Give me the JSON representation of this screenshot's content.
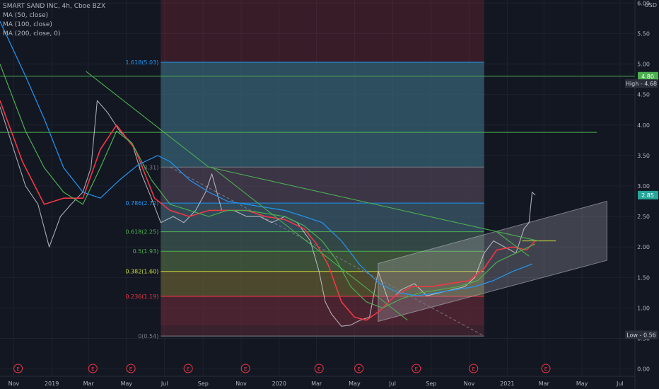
{
  "chart_data": {
    "type": "line",
    "title": "SMART SAND INC, 4h, Cboe BZX",
    "currency": "USD",
    "indicators": [
      "MA (50, close)",
      "MA (100, close)",
      "MA (200, close, 0)"
    ],
    "x_tick_labels": [
      "Nov",
      "2019",
      "Mar",
      "May",
      "Jul",
      "Sep",
      "Nov",
      "2020",
      "Mar",
      "May",
      "Jul",
      "Sep",
      "Nov",
      "2021",
      "Mar",
      "May",
      "Jul"
    ],
    "x_tick_dates": [
      "2018-11-01",
      "2019-01-01",
      "2019-03-01",
      "2019-05-01",
      "2019-07-01",
      "2019-09-01",
      "2019-11-01",
      "2020-01-01",
      "2020-03-01",
      "2020-05-01",
      "2020-07-01",
      "2020-09-01",
      "2020-11-01",
      "2021-01-01",
      "2021-03-01",
      "2021-05-01",
      "2021-07-01"
    ],
    "y_ticks": [
      "6.00",
      "5.50",
      "5.00",
      "4.50",
      "4.00",
      "3.50",
      "3.00",
      "2.50",
      "2.00",
      "1.50",
      "1.00",
      "0.50",
      "0.00"
    ],
    "ylim": [
      -0.12,
      6.05
    ],
    "xlim": [
      "2018-10-10",
      "2021-07-25"
    ],
    "price": {
      "x": [
        "2018-10-10",
        "2018-11-01",
        "2018-11-20",
        "2018-12-10",
        "2018-12-28",
        "2019-01-15",
        "2019-02-01",
        "2019-02-20",
        "2019-03-05",
        "2019-03-15",
        "2019-04-01",
        "2019-04-20",
        "2019-05-10",
        "2019-05-25",
        "2019-06-10",
        "2019-06-25",
        "2019-07-15",
        "2019-08-01",
        "2019-08-20",
        "2019-09-05",
        "2019-09-15",
        "2019-10-01",
        "2019-10-20",
        "2019-11-10",
        "2019-12-01",
        "2019-12-20",
        "2020-01-10",
        "2020-01-30",
        "2020-02-20",
        "2020-03-05",
        "2020-03-15",
        "2020-03-25",
        "2020-04-10",
        "2020-04-25",
        "2020-05-10",
        "2020-05-25",
        "2020-06-08",
        "2020-06-25",
        "2020-07-15",
        "2020-08-05",
        "2020-08-25",
        "2020-09-15",
        "2020-10-05",
        "2020-10-25",
        "2020-11-10",
        "2020-11-25",
        "2020-12-10",
        "2020-12-28",
        "2021-01-15",
        "2021-01-28",
        "2021-02-05",
        "2021-02-10",
        "2021-02-15"
      ],
      "y": [
        4.3,
        3.6,
        3.0,
        2.7,
        2.0,
        2.5,
        2.7,
        2.9,
        3.3,
        4.4,
        4.2,
        3.9,
        3.7,
        3.2,
        2.8,
        2.4,
        2.5,
        2.4,
        2.6,
        2.9,
        3.2,
        2.6,
        2.6,
        2.5,
        2.5,
        2.4,
        2.5,
        2.4,
        2.1,
        1.6,
        1.1,
        0.9,
        0.7,
        0.72,
        0.8,
        0.85,
        1.6,
        1.1,
        1.3,
        1.4,
        1.2,
        1.25,
        1.3,
        1.35,
        1.5,
        1.9,
        2.1,
        2.0,
        1.9,
        2.3,
        2.4,
        2.9,
        2.85
      ]
    },
    "series": [
      {
        "name": "MA (50, close)",
        "color": "#f23645",
        "x": [
          "2018-10-10",
          "2018-11-15",
          "2018-12-20",
          "2019-01-20",
          "2019-02-20",
          "2019-03-20",
          "2019-04-15",
          "2019-05-15",
          "2019-06-15",
          "2019-07-10",
          "2019-08-10",
          "2019-09-10",
          "2019-10-10",
          "2019-11-10",
          "2019-12-10",
          "2020-01-10",
          "2020-02-10",
          "2020-03-01",
          "2020-03-20",
          "2020-04-10",
          "2020-05-01",
          "2020-05-20",
          "2020-06-10",
          "2020-07-05",
          "2020-08-01",
          "2020-09-01",
          "2020-10-01",
          "2020-11-01",
          "2020-11-25",
          "2020-12-15",
          "2021-01-10",
          "2021-02-01",
          "2021-02-15"
        ],
        "y": [
          4.4,
          3.4,
          2.7,
          2.8,
          2.8,
          3.6,
          4.0,
          3.6,
          2.8,
          2.6,
          2.5,
          2.6,
          2.6,
          2.6,
          2.5,
          2.45,
          2.3,
          2.05,
          1.7,
          1.1,
          0.85,
          0.8,
          0.95,
          1.2,
          1.35,
          1.35,
          1.4,
          1.45,
          1.65,
          1.95,
          2.0,
          1.95,
          2.1
        ]
      },
      {
        "name": "MA (100, close)",
        "color": "#4caf50",
        "x": [
          "2018-10-10",
          "2018-11-20",
          "2018-12-20",
          "2019-01-20",
          "2019-02-20",
          "2019-03-20",
          "2019-04-15",
          "2019-05-10",
          "2019-06-10",
          "2019-07-10",
          "2019-08-10",
          "2019-09-10",
          "2019-10-10",
          "2019-11-10",
          "2019-12-10",
          "2020-01-10",
          "2020-02-10",
          "2020-03-10",
          "2020-04-01",
          "2020-04-25",
          "2020-05-20",
          "2020-06-15",
          "2020-07-15",
          "2020-08-15",
          "2020-09-15",
          "2020-10-15",
          "2020-11-15",
          "2020-12-15",
          "2021-01-15",
          "2021-02-15"
        ],
        "y": [
          5.0,
          3.9,
          3.3,
          2.9,
          2.7,
          3.3,
          3.9,
          3.7,
          3.1,
          2.7,
          2.6,
          2.5,
          2.6,
          2.6,
          2.55,
          2.5,
          2.35,
          2.1,
          1.8,
          1.35,
          1.1,
          1.0,
          1.15,
          1.25,
          1.3,
          1.35,
          1.45,
          1.75,
          1.9,
          2.05
        ]
      },
      {
        "name": "MA (200, close, 0)",
        "color": "#2196f3",
        "x": [
          "2018-10-10",
          "2018-11-20",
          "2018-12-20",
          "2019-01-20",
          "2019-02-20",
          "2019-03-20",
          "2019-04-20",
          "2019-05-20",
          "2019-06-20",
          "2019-07-10",
          "2019-08-10",
          "2019-09-10",
          "2019-10-10",
          "2019-11-10",
          "2019-12-10",
          "2020-01-10",
          "2020-02-10",
          "2020-03-10",
          "2020-04-10",
          "2020-05-10",
          "2020-06-10",
          "2020-07-10",
          "2020-08-10",
          "2020-09-10",
          "2020-10-10",
          "2020-11-10",
          "2020-12-10",
          "2021-01-10",
          "2021-02-10"
        ],
        "y": [
          5.7,
          4.8,
          4.1,
          3.3,
          2.9,
          2.8,
          3.1,
          3.35,
          3.5,
          3.4,
          3.1,
          2.9,
          2.75,
          2.7,
          2.65,
          2.6,
          2.5,
          2.4,
          2.1,
          1.7,
          1.4,
          1.25,
          1.2,
          1.25,
          1.3,
          1.35,
          1.45,
          1.6,
          1.72
        ]
      }
    ],
    "horizontal_lines": [
      {
        "y": 4.8,
        "color": "#4caf50",
        "x_start": "2018-10-10",
        "x_end": "2021-07-25"
      },
      {
        "y": 3.88,
        "color": "#4caf50",
        "x_start": "2018-10-10",
        "x_end": "2021-05-25"
      },
      {
        "y": 2.1,
        "color": "#cddc39",
        "x_start": "2021-01-25",
        "x_end": "2021-03-20"
      }
    ],
    "trendlines": [
      {
        "from": [
          "2019-02-25",
          4.88
        ],
        "to": [
          "2019-09-10",
          3.31
        ],
        "color": "#4caf50"
      },
      {
        "from": [
          "2019-09-10",
          3.31
        ],
        "to": [
          "2021-02-20",
          2.1
        ],
        "color": "#4caf50"
      },
      {
        "from": [
          "2019-09-15",
          3.31
        ],
        "to": [
          "2020-07-25",
          0.8
        ],
        "color": "#4caf50"
      },
      {
        "from": [
          "2020-12-15",
          2.25
        ],
        "to": [
          "2021-02-05",
          1.85
        ],
        "color": "#4caf50"
      }
    ],
    "dashed_lines": [
      {
        "from": [
          "2019-07-10",
          3.31
        ],
        "to": [
          "2020-11-25",
          0.54
        ],
        "color": "#787b86"
      }
    ],
    "channel": {
      "lower_from": [
        "2020-06-08",
        0.78
      ],
      "lower_to": [
        "2021-06-10",
        1.78
      ],
      "upper_from": [
        "2020-06-08",
        1.73
      ],
      "upper_to": [
        "2021-06-10",
        2.75
      ]
    },
    "date_range_box": {
      "from": "2019-06-25",
      "to": "2020-11-25",
      "color": "#f23645"
    },
    "fibonacci": {
      "x_start": "2019-06-25",
      "x_end": "2020-11-25",
      "levels": [
        {
          "ratio": "1.618",
          "value": 5.03,
          "label": "1.618(5.03)",
          "color": "#2196f3",
          "fill": "#24788c"
        },
        {
          "ratio": "1",
          "value": 3.31,
          "label": "1(3.31)",
          "color": "#787b86",
          "fill": "#3e4a5e"
        },
        {
          "ratio": "0.786",
          "value": 2.72,
          "label": "0.786(2.72)",
          "color": "#2196f3",
          "fill": "#2b6e80"
        },
        {
          "ratio": "0.618",
          "value": 2.25,
          "label": "0.618(2.25)",
          "color": "#4caf50",
          "fill": "#2e6a5c"
        },
        {
          "ratio": "0.5",
          "value": 1.93,
          "label": "0.5(1.93)",
          "color": "#4caf50",
          "fill": "#3f7a46"
        },
        {
          "ratio": "0.382",
          "value": 1.6,
          "label": "0.382(1.60)",
          "color": "#cddc39",
          "fill": "#5c6d33"
        },
        {
          "ratio": "0.236",
          "value": 1.19,
          "label": "0.236(1.19)",
          "color": "#f23645",
          "fill": "#5a2a36"
        },
        {
          "ratio": "0",
          "value": 0.54,
          "label": "0(0.54)",
          "color": "#787b86",
          "fill": "#5a2a36"
        }
      ]
    },
    "events": [
      "2018-11-08",
      "2019-03-08",
      "2019-05-08",
      "2019-08-08",
      "2019-11-08",
      "2020-03-05",
      "2020-05-08",
      "2020-08-08",
      "2020-11-08",
      "2021-03-04"
    ],
    "event_label": "E",
    "price_labels": [
      {
        "text": "4.80",
        "value": 4.8,
        "color": "#4caf50"
      },
      {
        "text": "2.85",
        "value": 2.85,
        "color": "#26a69a"
      }
    ],
    "extreme_labels": [
      {
        "text": "High - 4.68",
        "value": 4.68
      },
      {
        "text": "Low - 0.56",
        "value": 0.56
      }
    ]
  }
}
